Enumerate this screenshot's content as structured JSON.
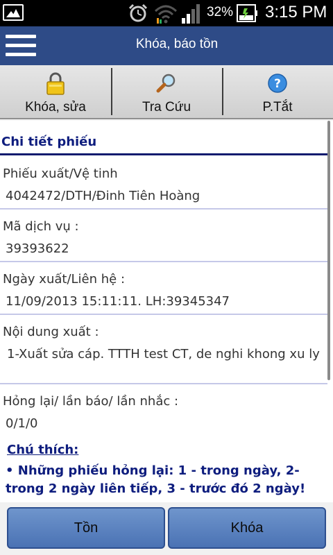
{
  "status_bar": {
    "battery_percent": "32%",
    "time": "3:15 PM",
    "icons": [
      "gallery-icon",
      "alarm-icon",
      "wifi-icon",
      "signal-icon",
      "battery-icon"
    ]
  },
  "title_bar": {
    "title": "Khóa, báo tồn"
  },
  "toolbar": {
    "items": [
      {
        "label": "Khóa, sửa",
        "icon": "lock-icon"
      },
      {
        "label": "Tra Cứu",
        "icon": "magnifier-icon"
      },
      {
        "label": "P.Tắt",
        "icon": "help-icon"
      }
    ]
  },
  "detail": {
    "section_title": "Chi tiết phiếu",
    "fields": [
      {
        "label": "Phiếu xuất/Vệ tinh",
        "value": "4042472/DTH/Đinh Tiên Hoàng"
      },
      {
        "label": "Mã dịch vụ :",
        "value": "39393622"
      },
      {
        "label": "Ngày xuất/Liên hệ :",
        "value": "11/09/2013 15:11:11. LH:39345347"
      },
      {
        "label": "Nội dung xuất :",
        "value": "1-Xuất sửa cáp. TTTH test CT, de nghi khong xu ly"
      },
      {
        "label": "Hỏng lại/ lần báo/ lần nhắc :",
        "value": "0/1/0"
      }
    ],
    "notes_title": "Chú thích:",
    "notes": [
      "• Những phiếu hỏng lại: 1 - trong ngày, 2- trong 2 ngày liên tiếp, 3 - trước đó 2 ngày!"
    ]
  },
  "buttons": {
    "left": "Tồn",
    "right": "Khóa"
  },
  "colors": {
    "title_bar": "#2e4b87",
    "section_text": "#0e1d7e",
    "button": "#5a82c0"
  }
}
